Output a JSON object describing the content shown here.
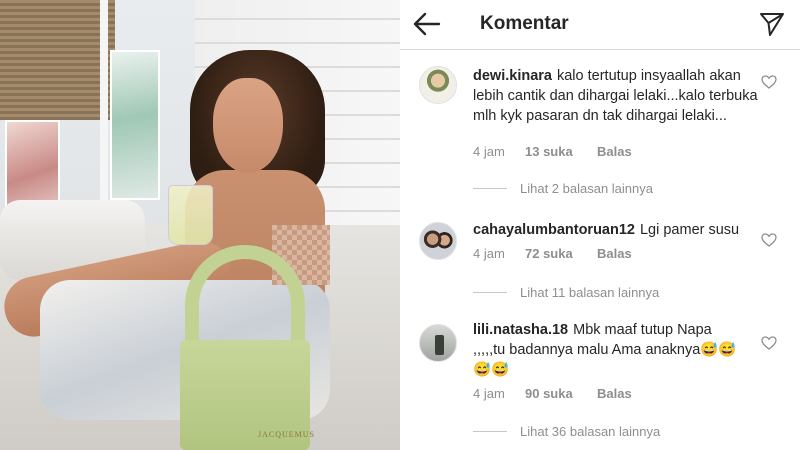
{
  "photo": {
    "bag_logo": "JACQUEMUS"
  },
  "header": {
    "title": "Komentar",
    "back_icon": "back-arrow-icon",
    "send_icon": "direct-send-icon"
  },
  "comments": [
    {
      "username": "dewi.kinara",
      "text": "kalo tertutup insyaallah akan lebih cantik dan dihargai lelaki...kalo terbuka mlh kyk pasaran dn tak dihargai lelaki...",
      "time": "4 jam",
      "likes": "13 suka",
      "reply": "Balas",
      "view_replies": "Lihat 2 balasan lainnya"
    },
    {
      "username": "cahayalumbantoruan12",
      "text": "Lgi pamer susu",
      "time": "4 jam",
      "likes": "72 suka",
      "reply": "Balas",
      "view_replies": "Lihat 11 balasan lainnya"
    },
    {
      "username": "lili.natasha.18",
      "text": "Mbk maaf tutup Napa ,,,,,tu badannya malu Ama anaknya😅😅😅😅",
      "time": "4 jam",
      "likes": "90 suka",
      "reply": "Balas",
      "view_replies": "Lihat 36 balasan lainnya"
    }
  ]
}
